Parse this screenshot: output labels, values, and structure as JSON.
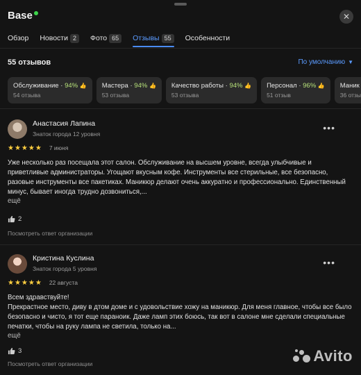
{
  "app": {
    "title": "Base"
  },
  "tabs": [
    {
      "label": "Обзор",
      "count": null
    },
    {
      "label": "Новости",
      "count": "2"
    },
    {
      "label": "Фото",
      "count": "65"
    },
    {
      "label": "Отзывы",
      "count": "55",
      "active": true
    },
    {
      "label": "Особенности",
      "count": null
    }
  ],
  "reviews_header": {
    "count_text": "55 отзывов",
    "sort_label": "По умолчанию"
  },
  "chips": [
    {
      "label": "Обслуживание",
      "percent": "94%",
      "sub": "54 отзыва"
    },
    {
      "label": "Мастера",
      "percent": "94%",
      "sub": "53 отзыва"
    },
    {
      "label": "Качество работы",
      "percent": "94%",
      "sub": "53 отзыва"
    },
    {
      "label": "Персонал",
      "percent": "96%",
      "sub": "51 отзыв"
    },
    {
      "label": "Маник",
      "percent": "",
      "sub": "36 отзы"
    }
  ],
  "reviews": [
    {
      "name": "Анастасия Лапина",
      "level": "Знаток города 12 уровня",
      "rating": 5,
      "stars": "★★★★★",
      "date": "7 июня",
      "text": [
        "Уже несколько раз посещала этот салон. Обслуживание на высшем уровне, всегда улыбчивые и приветливые администраторы. Угощают вкусным кофе. Инструменты все стерильные, все безопасно, разовые инструменты все пакетиках. Маникюр делают очень аккуратно и профессионально. Единственный минус, бывает иногда трудно дозвониться,..."
      ],
      "more": "ещё",
      "likes": "2",
      "reply": "Посмотреть ответ организации"
    },
    {
      "name": "Кристина Куслина",
      "level": "Знаток города 5 уровня",
      "rating": 5,
      "stars": "★★★★★",
      "date": "22 августа",
      "text": [
        "Всем здравствуйте!",
        "Прекрастное место, диву в дтом доме и с удовольствие хожу на маникюр. Для меня главное, чтобы все было безопасно и чисто, я тот еще параноик. Даже ламп этих боюсь, так вот в салоне мне сделали специальные печатки, чтобы на руку лампа не светила, только на..."
      ],
      "more": "ещё",
      "likes": "3",
      "reply": "Посмотреть ответ организации"
    }
  ],
  "icons": {
    "close": "close-icon",
    "like": "thumbs-up-icon",
    "more": "more-dots-icon",
    "sort": "chevron-down-icon"
  },
  "colors": {
    "accent": "#4a8cff",
    "positive": "#b7e27a",
    "star": "#ffcf40",
    "status_dot": "#3dd54b"
  },
  "watermark": {
    "text": "Avito"
  }
}
